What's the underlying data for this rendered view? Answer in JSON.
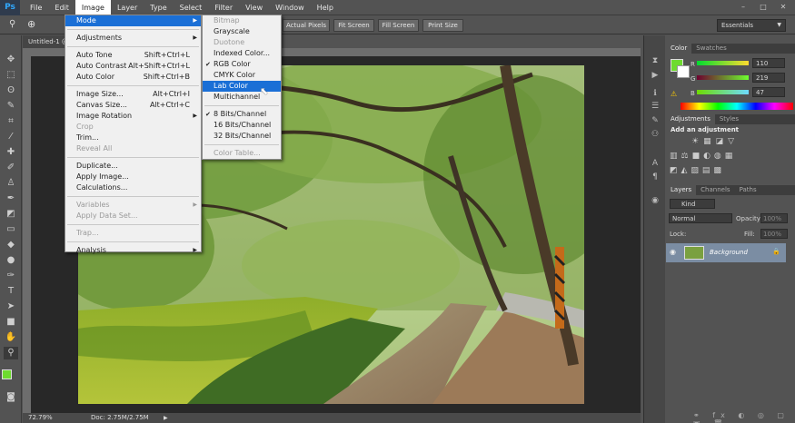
{
  "app": {
    "logo": "Ps"
  },
  "menubar": {
    "items": [
      "File",
      "Edit",
      "Image",
      "Layer",
      "Type",
      "Select",
      "Filter",
      "View",
      "Window",
      "Help"
    ]
  },
  "window_buttons": [
    "–",
    "□",
    "✕"
  ],
  "optbar": {
    "buttons": [
      "Actual Pixels",
      "Fit Screen",
      "Fill Screen",
      "Print Size"
    ],
    "workspace": "Essentials"
  },
  "document": {
    "tab": "Untitled-1 @",
    "zoom": "72.79%",
    "doc_info": "Doc: 2.75M/2.75M"
  },
  "image_menu": {
    "items": [
      {
        "label": "Mode",
        "shortcut": "",
        "submenu": true,
        "disabled": false,
        "highlight": true
      },
      {
        "sep": true
      },
      {
        "label": "Adjustments",
        "shortcut": "",
        "submenu": true,
        "disabled": false
      },
      {
        "sep": true
      },
      {
        "label": "Auto Tone",
        "shortcut": "Shift+Ctrl+L",
        "disabled": false
      },
      {
        "label": "Auto Contrast",
        "shortcut": "Alt+Shift+Ctrl+L",
        "disabled": false
      },
      {
        "label": "Auto Color",
        "shortcut": "Shift+Ctrl+B",
        "disabled": false
      },
      {
        "sep": true
      },
      {
        "label": "Image Size...",
        "shortcut": "Alt+Ctrl+I",
        "disabled": false
      },
      {
        "label": "Canvas Size...",
        "shortcut": "Alt+Ctrl+C",
        "disabled": false
      },
      {
        "label": "Image Rotation",
        "shortcut": "",
        "submenu": true,
        "disabled": false
      },
      {
        "label": "Crop",
        "shortcut": "",
        "disabled": true
      },
      {
        "label": "Trim...",
        "shortcut": "",
        "disabled": false
      },
      {
        "label": "Reveal All",
        "shortcut": "",
        "disabled": true
      },
      {
        "sep": true
      },
      {
        "label": "Duplicate...",
        "shortcut": "",
        "disabled": false
      },
      {
        "label": "Apply Image...",
        "shortcut": "",
        "disabled": false
      },
      {
        "label": "Calculations...",
        "shortcut": "",
        "disabled": false
      },
      {
        "sep": true
      },
      {
        "label": "Variables",
        "shortcut": "",
        "submenu": true,
        "disabled": true
      },
      {
        "label": "Apply Data Set...",
        "shortcut": "",
        "disabled": true
      },
      {
        "sep": true
      },
      {
        "label": "Trap...",
        "shortcut": "",
        "disabled": true
      },
      {
        "sep": true
      },
      {
        "label": "Analysis",
        "shortcut": "",
        "submenu": true,
        "disabled": false
      }
    ]
  },
  "mode_menu": {
    "items": [
      {
        "label": "Bitmap",
        "disabled": true
      },
      {
        "label": "Grayscale",
        "disabled": false
      },
      {
        "label": "Duotone",
        "disabled": true
      },
      {
        "label": "Indexed Color...",
        "disabled": false
      },
      {
        "label": "RGB Color",
        "disabled": false,
        "checked": true
      },
      {
        "label": "CMYK Color",
        "disabled": false
      },
      {
        "label": "Lab Color",
        "disabled": false,
        "highlight": true
      },
      {
        "label": "Multichannel",
        "disabled": false
      },
      {
        "sep": true
      },
      {
        "label": "8 Bits/Channel",
        "disabled": false,
        "checked": true
      },
      {
        "label": "16 Bits/Channel",
        "disabled": false
      },
      {
        "label": "32 Bits/Channel",
        "disabled": false
      },
      {
        "sep": true
      },
      {
        "label": "Color Table...",
        "disabled": true
      }
    ]
  },
  "color_panel": {
    "tabs": [
      "Color",
      "Swatches"
    ],
    "channels": [
      {
        "label": "R",
        "value": "110"
      },
      {
        "label": "G",
        "value": "219"
      },
      {
        "label": "B",
        "value": "47"
      }
    ],
    "foreground": "#6edb2f"
  },
  "adjustments_panel": {
    "tabs": [
      "Adjustments",
      "Styles"
    ],
    "title": "Add an adjustment"
  },
  "layers_panel": {
    "tabs": [
      "Layers",
      "Channels",
      "Paths"
    ],
    "filter": "Kind",
    "blend_mode": "Normal",
    "opacity_label": "Opacity:",
    "opacity_value": "100%",
    "lock_label": "Lock:",
    "fill_label": "Fill:",
    "fill_value": "100%",
    "layer_name": "Background"
  },
  "colors": {
    "accent": "#1a6fd6",
    "panel": "#535353",
    "canvas_bg": "#282828"
  }
}
